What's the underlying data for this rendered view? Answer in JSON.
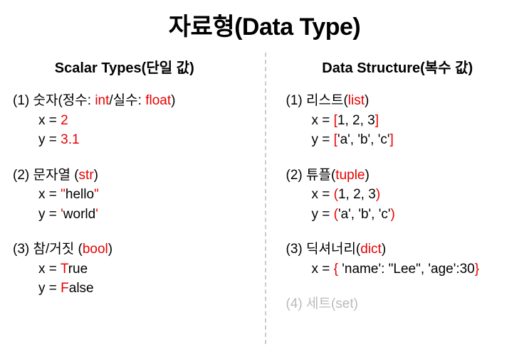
{
  "title": "자료형(Data Type)",
  "left": {
    "heading": "Scalar Types(단일 값)",
    "s1": {
      "num": "(1) ",
      "t1": "숫자(정수: ",
      "int": "int",
      "t2": "/실수: ",
      "float": "float",
      "t3": ")",
      "l1a": "x = ",
      "l1b": "2",
      "l2a": "y = ",
      "l2b": "3.1"
    },
    "s2": {
      "num": "(2) ",
      "t1": "문자열 (",
      "str": "str",
      "t2": ")",
      "l1a": "x = ",
      "l1q1": "\"",
      "l1b": "hello",
      "l1q2": "\"",
      "l2a": "y = ",
      "l2q1": "'",
      "l2b": "world",
      "l2q2": "'"
    },
    "s3": {
      "num": "(3) ",
      "t1": "참/거짓 (",
      "bool": "bool",
      "t2": ")",
      "l1a": "x = ",
      "l1T": "T",
      "l1b": "rue",
      "l2a": "y = ",
      "l2F": "F",
      "l2b": "alse"
    }
  },
  "right": {
    "heading": "Data Structure(복수 값)",
    "s1": {
      "num": "(1) ",
      "t1": "리스트(",
      "list": "list",
      "t2": ")",
      "l1a": "x = ",
      "l1b1": "[",
      "l1b2": "1, 2, 3",
      "l1b3": "]",
      "l2a": "y = ",
      "l2b1": "[",
      "l2b2": "'a', 'b', 'c'",
      "l2b3": "]"
    },
    "s2": {
      "num": "(2) ",
      "t1": "튜플(",
      "tuple": "tuple",
      "t2": ")",
      "l1a": "x = ",
      "l1b1": "(",
      "l1b2": "1, 2, 3",
      "l1b3": ")",
      "l2a": "y = ",
      "l2b1": "(",
      "l2b2": "'a', 'b', 'c'",
      "l2b3": ")"
    },
    "s3": {
      "num": "(3) ",
      "t1": "딕셔너리(",
      "dict": "dict",
      "t2": ")",
      "l1a": "x = ",
      "l1b1": "{",
      "l1b2": " 'name': \"Lee\", 'age':30",
      "l1b3": "}"
    },
    "s4": {
      "num": "(4) ",
      "t1": "세트(",
      "set": "set",
      "t2": ")"
    }
  }
}
